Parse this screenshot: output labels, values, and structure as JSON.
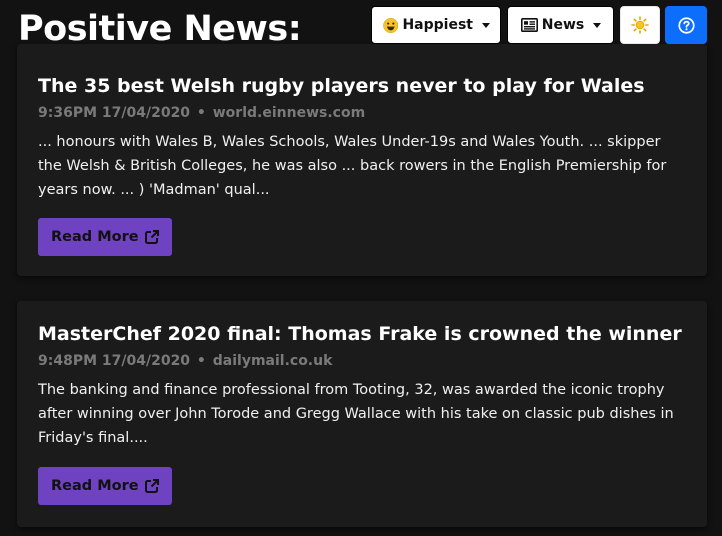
{
  "header": {
    "title": "Positive News:",
    "sort_label": "Happiest",
    "category_label": "News"
  },
  "colors": {
    "background": "#121212",
    "card": "#1b1b1b",
    "accent": "#6f42c1",
    "help": "#0d6efd",
    "meta": "#7a7a7a"
  },
  "icons": {
    "sort": "smiling-face-icon",
    "category": "newspaper-icon",
    "theme": "sun-icon",
    "help": "question-circle-icon",
    "read_more": "external-link-icon"
  },
  "articles": [
    {
      "title": "The 35 best Welsh rugby players never to play for Wales",
      "time": "9:36PM 17/04/2020",
      "source": "world.einnews.com",
      "excerpt": "... honours with Wales B, Wales Schools, Wales Under-19s and Wales Youth. ... skipper the Welsh & British Colleges, he was also ... back rowers in the English Premiership for years now. ... ) 'Madman' qual...",
      "button_label": "Read More"
    },
    {
      "title": "MasterChef 2020 final: Thomas Frake is crowned the winner",
      "time": "9:48PM 17/04/2020",
      "source": "dailymail.co.uk",
      "excerpt": "The banking and finance professional from Tooting, 32, was awarded the iconic trophy after winning over John Torode and Gregg Wallace with his take on classic pub dishes in Friday's final....",
      "button_label": "Read More"
    }
  ]
}
